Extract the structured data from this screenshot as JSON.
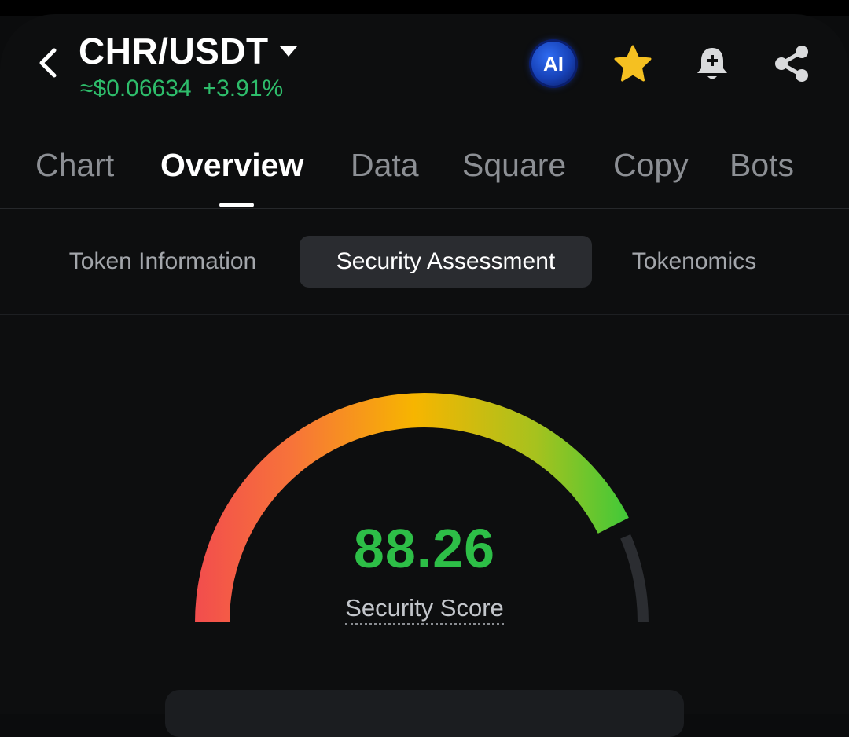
{
  "header": {
    "pair": "CHR/USDT",
    "price": "≈$0.06634",
    "change": "+3.91%",
    "ai_label": "AI"
  },
  "main_tabs": [
    {
      "label": "Chart",
      "active": false
    },
    {
      "label": "Overview",
      "active": true
    },
    {
      "label": "Data",
      "active": false
    },
    {
      "label": "Square",
      "active": false
    },
    {
      "label": "Copy",
      "active": false
    },
    {
      "label": "Bots",
      "active": false
    }
  ],
  "sub_tabs": [
    {
      "label": "Token Information",
      "active": false
    },
    {
      "label": "Security Assessment",
      "active": true
    },
    {
      "label": "Tokenomics",
      "active": false
    }
  ],
  "security": {
    "score": "88.26",
    "score_fraction": 0.8826,
    "label": "Security Score"
  },
  "icons": [
    "back-arrow-icon",
    "caret-down-icon",
    "ai-icon",
    "star-icon",
    "bell-plus-icon",
    "share-icon"
  ],
  "colors": {
    "positive": "#2ebd6b",
    "score": "#2dbe47",
    "star": "#f5c021",
    "gauge_start": "#f24d4d",
    "gauge_mid": "#f7b500",
    "gauge_end": "#3cc93a"
  }
}
